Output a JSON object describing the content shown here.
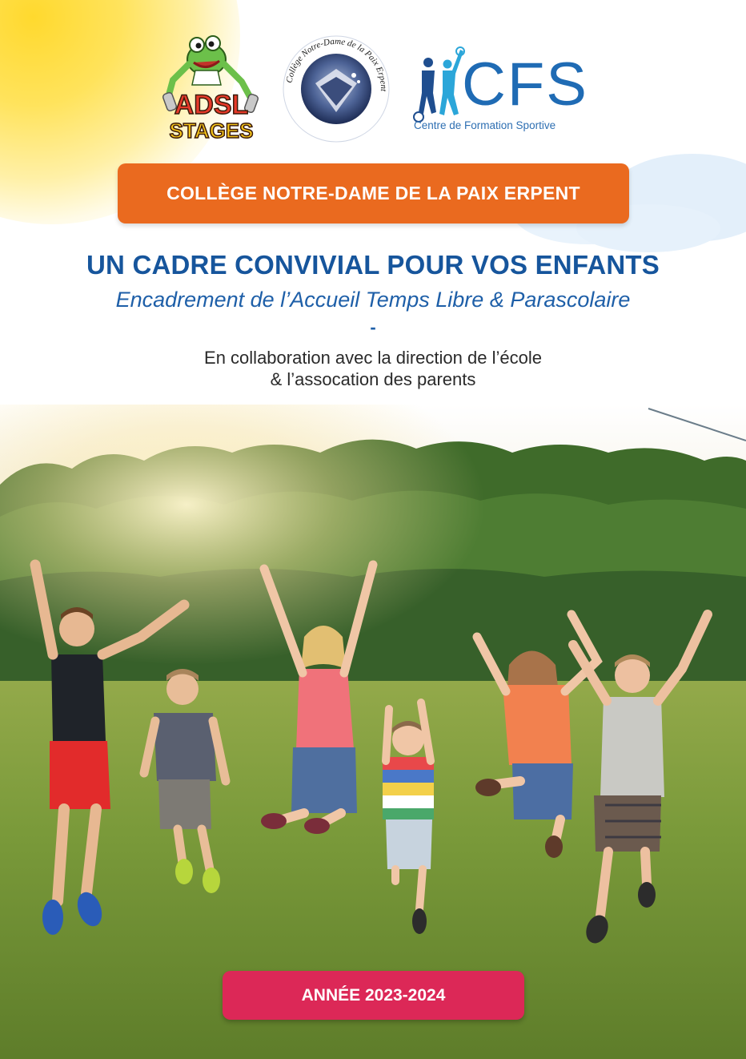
{
  "logos": {
    "adsl": {
      "line1": "ADSL",
      "line2": "STAGES"
    },
    "college_seal": "Collège Notre-Dame de la Paix Erpent",
    "cfs": {
      "letters": "CFS",
      "subtitle": "Centre de Formation Sportive"
    }
  },
  "banner_college": "COLLÈGE NOTRE-DAME DE LA PAIX ERPENT",
  "headline": "UN CADRE CONVIVIAL POUR VOS ENFANTS",
  "subheadline": "Encadrement de l’Accueil Temps Libre & Parascolaire",
  "separator": "-",
  "collaboration": {
    "line1": "En collaboration avec la direction de l’école",
    "line2": "& l’assocation des parents"
  },
  "photo": {
    "subject": "children-jumping-in-park"
  },
  "banner_year": "ANNÉE 2023-2024",
  "colors": {
    "orange_banner": "#ea6a1f",
    "pink_banner": "#dc2857",
    "headline_blue": "#16559c",
    "grass_green": "#7a9a3a",
    "tree_green": "#3f6b2a"
  }
}
